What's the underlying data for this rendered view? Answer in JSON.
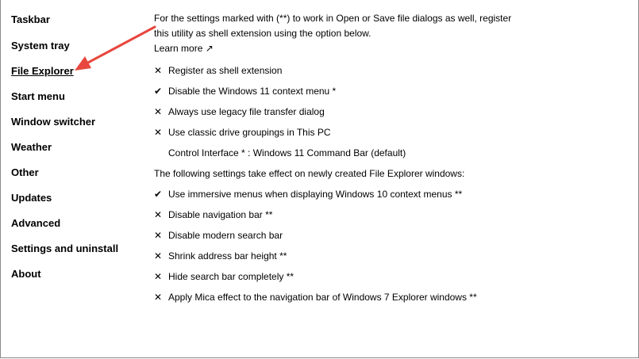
{
  "sidebar": {
    "items": [
      {
        "label": "Taskbar"
      },
      {
        "label": "System tray"
      },
      {
        "label": "File Explorer"
      },
      {
        "label": "Start menu"
      },
      {
        "label": "Window switcher"
      },
      {
        "label": "Weather"
      },
      {
        "label": "Other"
      },
      {
        "label": "Updates"
      },
      {
        "label": "Advanced"
      },
      {
        "label": "Settings and uninstall"
      },
      {
        "label": "About"
      }
    ],
    "active_label": "File Explorer"
  },
  "main": {
    "intro_line1": "For the settings marked with (**) to work in Open or Save file dialogs as well, register",
    "intro_line2": "this utility as shell extension using the option below.",
    "learn_more": "Learn more ↗",
    "options_a": [
      {
        "mark": "✕",
        "checked": false,
        "label": "Register as shell extension"
      },
      {
        "mark": "✔",
        "checked": true,
        "label": "Disable the Windows 11 context menu *"
      },
      {
        "mark": "✕",
        "checked": false,
        "label": "Always use legacy file transfer dialog"
      },
      {
        "mark": "✕",
        "checked": false,
        "label": "Use classic drive groupings in This PC"
      }
    ],
    "control_interface": "Control Interface * : Windows 11 Command Bar (default)",
    "section_note": "The following settings take effect on newly created File Explorer windows:",
    "options_b": [
      {
        "mark": "✔",
        "checked": true,
        "label": "Use immersive menus when displaying Windows 10 context menus **"
      },
      {
        "mark": "✕",
        "checked": false,
        "label": "Disable navigation bar **"
      },
      {
        "mark": "✕",
        "checked": false,
        "label": "Disable modern search bar"
      },
      {
        "mark": "✕",
        "checked": false,
        "label": "Shrink address bar height **"
      },
      {
        "mark": "✕",
        "checked": false,
        "label": "Hide search bar completely **"
      },
      {
        "mark": "✕",
        "checked": false,
        "label": "Apply Mica effect to the navigation bar of Windows 7 Explorer windows **"
      }
    ]
  },
  "annotation": {
    "arrow_color": "#e8473f",
    "icon": "red-arrow-pointer"
  }
}
